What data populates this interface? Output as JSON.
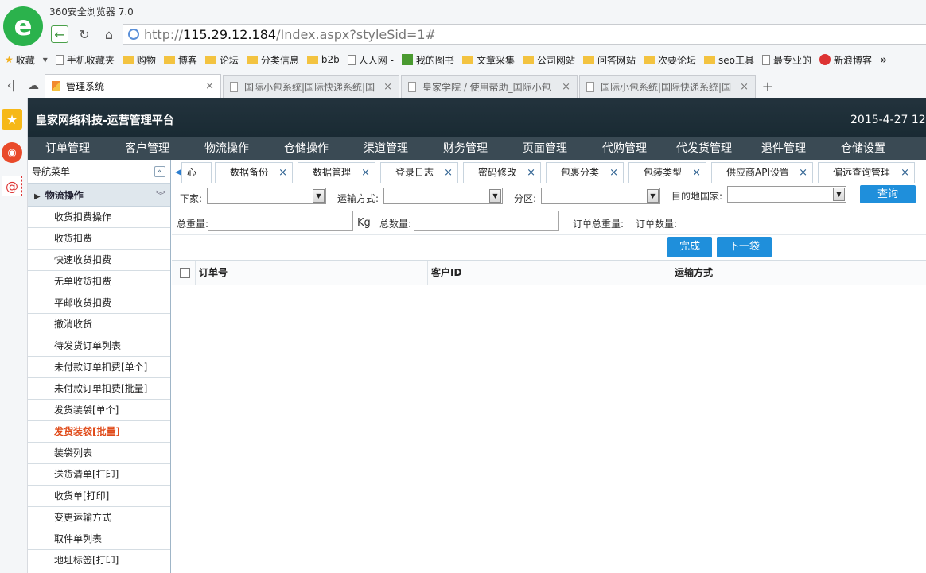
{
  "browser": {
    "title": "360安全浏览器 7.0",
    "url_scheme": "http://",
    "url_host": "115.29.12.184",
    "url_path": "/Index.aspx?styleSid=1#",
    "bookmarks": [
      {
        "label": "收藏",
        "kind": "star"
      },
      {
        "label": "手机收藏夹",
        "kind": "page"
      },
      {
        "label": "购物",
        "kind": "folder"
      },
      {
        "label": "博客",
        "kind": "folder"
      },
      {
        "label": "论坛",
        "kind": "folder"
      },
      {
        "label": "分类信息",
        "kind": "folder"
      },
      {
        "label": "b2b",
        "kind": "folder"
      },
      {
        "label": "人人网 -",
        "kind": "page"
      },
      {
        "label": "我的图书",
        "kind": "green"
      },
      {
        "label": "文章采集",
        "kind": "folder"
      },
      {
        "label": "公司网站",
        "kind": "folder"
      },
      {
        "label": "问答网站",
        "kind": "folder"
      },
      {
        "label": "次要论坛",
        "kind": "folder"
      },
      {
        "label": "seo工具",
        "kind": "folder"
      },
      {
        "label": "最专业的",
        "kind": "page"
      },
      {
        "label": "新浪博客",
        "kind": "red"
      }
    ],
    "more_bookmarks": "»",
    "tabs": [
      {
        "label": "管理系统",
        "active": true
      },
      {
        "label": "国际小包系统|国际快递系统|国",
        "active": false
      },
      {
        "label": "皇家学院 / 使用帮助_国际小包",
        "active": false
      },
      {
        "label": "国际小包系统|国际快递系统|国",
        "active": false
      }
    ],
    "close_glyph": "×",
    "newtab_glyph": "+"
  },
  "app": {
    "title": "皇家网络科技-运营管理平台",
    "date": "2015-4-27 12:",
    "main_nav": [
      "订单管理",
      "客户管理",
      "物流操作",
      "仓储操作",
      "渠道管理",
      "财务管理",
      "页面管理",
      "代购管理",
      "代发货管理",
      "退件管理",
      "仓储设置",
      "报"
    ]
  },
  "sidebar": {
    "header": "导航菜单",
    "collapse_glyph": "«",
    "group": "物流操作",
    "group_glyph": "»",
    "items": [
      {
        "label": "收货扣费操作",
        "active": false
      },
      {
        "label": "收货扣费",
        "active": false
      },
      {
        "label": "快速收货扣费",
        "active": false
      },
      {
        "label": "无单收货扣费",
        "active": false
      },
      {
        "label": "平邮收货扣费",
        "active": false
      },
      {
        "label": "撤消收货",
        "active": false
      },
      {
        "label": "待发货订单列表",
        "active": false
      },
      {
        "label": "未付款订单扣费[单个]",
        "active": false
      },
      {
        "label": "未付款订单扣费[批量]",
        "active": false
      },
      {
        "label": "发货装袋[单个]",
        "active": false
      },
      {
        "label": "发货装袋[批量]",
        "active": true
      },
      {
        "label": "装袋列表",
        "active": false
      },
      {
        "label": "送货清单[打印]",
        "active": false
      },
      {
        "label": "收货单[打印]",
        "active": false
      },
      {
        "label": "变更运输方式",
        "active": false
      },
      {
        "label": "取件单列表",
        "active": false
      },
      {
        "label": "地址标签[打印]",
        "active": false
      }
    ]
  },
  "content_tabs": {
    "first_partial": "心",
    "tabs": [
      "数据备份",
      "数据管理",
      "登录日志",
      "密码修改",
      "包裹分类",
      "包装类型",
      "供应商API设置",
      "偏远查询管理"
    ],
    "close_glyph": "×"
  },
  "filters": {
    "agent_label": "下家:",
    "shipping_label": "运输方式:",
    "zone_label": "分区:",
    "country_label": "目的地国家:",
    "search_button": "查询",
    "total_weight_label": "总重量:",
    "weight_unit": "Kg",
    "total_count_label": "总数量:",
    "order_total_weight_label": "订单总重量:",
    "order_count_label": "订单数量:",
    "done_button": "完成",
    "next_bag_button": "下一袋"
  },
  "grid": {
    "columns": [
      "订单号",
      "客户ID",
      "运输方式"
    ]
  }
}
